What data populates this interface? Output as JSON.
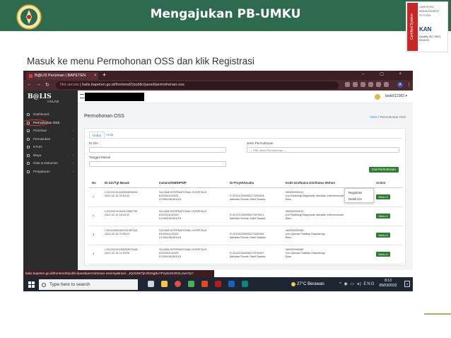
{
  "slide": {
    "title": "Mengajukan PB-UMKU",
    "subtitle": "Masuk ke menu Permohonan OSS dan klik Registrasi",
    "cert": {
      "top_text": "CERTIFIED MANAGEMENT SYSTEM",
      "side_text": "Certified System",
      "kan": "KAN",
      "quality": "Quality ISO 9001",
      "cert_no": "0018:20"
    }
  },
  "browser": {
    "tab_title": "B@LIS Perizinan | BAPETEN",
    "tab_close": "×",
    "new_tab": "+",
    "window_buttons": "– ▢ ×",
    "nav": {
      "back": "←",
      "forward": "→",
      "reload": "↻"
    },
    "security_label": "Not secure",
    "separator": "|",
    "url": "balis.bapeten.go.id/frontend2/public/panel/permohonan-oss",
    "profile_initial": "A",
    "menu": "⋮",
    "status_url": "balis.bapeten.go.id/frontend2/public/panel/permohonan-oss/registrasi/...JQc53W7jK3hS5gBxYPzy5nOURGLzwHYp?"
  },
  "app": {
    "brand": "B@LIS",
    "brand_sub": "ONLINE",
    "hamburger": "≡",
    "user_name": "balis012363",
    "user_caret": "▾",
    "sidebar": [
      {
        "label": "Dashboard",
        "chevron": ""
      },
      {
        "label": "Permohonan OSS",
        "chevron": ""
      },
      {
        "label": "Perizinan",
        "chevron": "›"
      },
      {
        "label": "Pemasukan",
        "chevron": "›"
      },
      {
        "label": "KTUN",
        "chevron": ""
      },
      {
        "label": "Biaya",
        "chevron": "›"
      },
      {
        "label": "Data & Dokumen",
        "chevron": "›"
      },
      {
        "label": "Pengaturan",
        "chevron": "›"
      }
    ],
    "page_title": "Permohonan OSS",
    "breadcrumb": {
      "link": "OSS",
      "sep": "/",
      "current": "Permohonan OSS"
    },
    "tabs": {
      "active": "Daftar",
      "other": "Arsip"
    },
    "filters": {
      "id_izin_label": "ID Izin",
      "jenis_label": "Jenis Permohonan",
      "jenis_value": "--- Pilih Jenis Permohonan ---",
      "tanggal_label": "Tanggal Masuk",
      "search_button": "Cari Permohonan"
    },
    "table": {
      "headers": [
        "No",
        "ID Izin/Tgl Masuk",
        "Instansi/NIB/NPWP",
        "ID Proyek/Usaha",
        "Kode Izin/Nama Izin/Status Mohon",
        "Action"
      ],
      "action_label": "Menu ▾",
      "rows": [
        {
          "no": "1",
          "id_izin": "I-202202101026594005253",
          "tgl": "2022-02-10 20:53:22",
          "instansi": "SILOAM INTERNATIONAL HOSPITALS",
          "nib": "8120014132425",
          "npwp": "017861082451001",
          "proyek": "R-201912300055273394394",
          "usaha": "Aktivitas Rumah Sakit Swasta",
          "kode": "080000000010",
          "nama": "Izin Radiologi Diagnostik dan/atau Intervensional",
          "status": "Baru"
        },
        {
          "no": "2",
          "id_izin": "I-202202141446115887735",
          "tgl": "2022-02-14 18:40:22",
          "instansi": "SILOAM INTERNATIONAL HOSPITALS",
          "nib": "8120014132425",
          "npwp": "017861082451001",
          "proyek": "R-201912300055273979921",
          "usaha": "Aktivitas Rumah Sakit Swasta",
          "kode": "080000000010",
          "nama": "Izin Radiologi Diagnostik dan/atau Intervensional",
          "status": "Baru"
        },
        {
          "no": "3",
          "id_izin": "I-202202081261011987316",
          "tgl": "2022-02-15 20:55:22",
          "instansi": "SILOAM INTERNATIONAL HOSPITALS",
          "nib": "8120014132425",
          "npwp": "017861082451001",
          "proyek": "R-201912300055273394394",
          "usaha": "Aktivitas Rumah Sakit Swasta",
          "kode": "080000000085",
          "nama": "Izin Operasi Fasilitas Radioterapi",
          "status": "Baru"
        },
        {
          "no": "4",
          "id_izin": "I-202202101038253979448",
          "tgl": "2022-02-15 11:54:26",
          "instansi": "SILOAM INTERNATIONAL HOSPITALS",
          "nib": "8120014132425",
          "npwp": "017861082451001",
          "proyek": "R-201912300055273709457",
          "usaha": "Aktivitas Rumah Sakit Swasta",
          "kode": "080000000085",
          "nama": "Izin Operasi Fasilitas Radioterapi",
          "status": "Baru"
        }
      ],
      "dropdown": [
        "Registrasi",
        "Detail Izin"
      ]
    }
  },
  "taskbar": {
    "search_placeholder": "Type here to search",
    "weather": "27°C  Berawan",
    "tray": "^ ◉ ▭ ◂) ENG",
    "time": "8:13",
    "date": "05/03/2022",
    "notif": "4"
  },
  "colors": {
    "header_green": "#2e6a4e",
    "browser_maroon": "#3c1f24",
    "sidebar_dark": "#2c2c2c",
    "action_green": "#2e7d32",
    "highlight_red": "#e53935",
    "link_blue": "#1e88e5"
  }
}
